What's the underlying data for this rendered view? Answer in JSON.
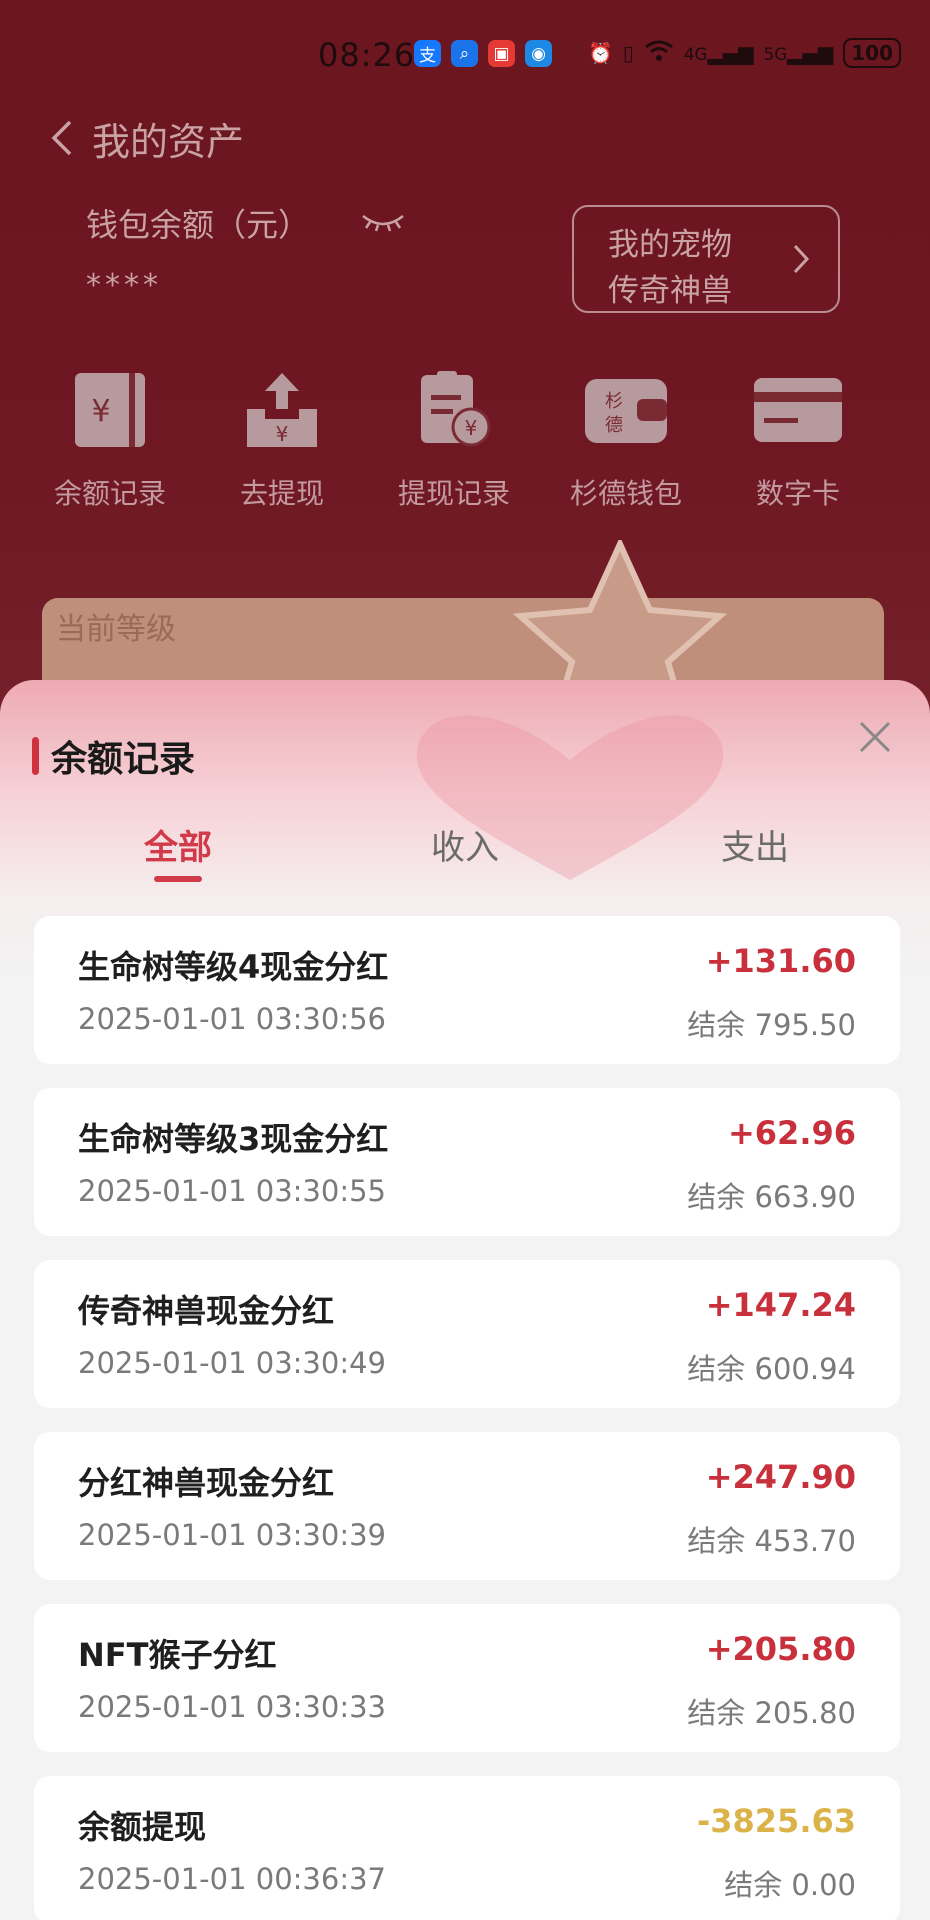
{
  "status_bar": {
    "time": "08:26",
    "app_icons": [
      {
        "icon": "alipay-icon",
        "glyph": "支",
        "color": "#1677ff"
      },
      {
        "icon": "search-app-icon",
        "glyph": "⌕",
        "color": "#1a73e8"
      },
      {
        "icon": "red-app-icon",
        "glyph": "▣",
        "color": "#e53935"
      },
      {
        "icon": "blue-app-icon",
        "glyph": "◉",
        "color": "#1e88e5"
      }
    ],
    "signal_4g": "4G",
    "signal_5g": "5G",
    "battery": "100"
  },
  "header": {
    "title": "我的资产"
  },
  "wallet": {
    "label": "钱包余额（元）",
    "amount_masked": "****"
  },
  "pet_box": {
    "line1": "我的宠物",
    "line2": "传奇神兽"
  },
  "quick_actions": [
    {
      "label": "余额记录",
      "icon": "balance-record-icon"
    },
    {
      "label": "去提现",
      "icon": "withdraw-icon"
    },
    {
      "label": "提现记录",
      "icon": "withdraw-record-icon"
    },
    {
      "label": "杉德钱包",
      "icon": "sande-wallet-icon"
    },
    {
      "label": "数字卡",
      "icon": "digital-card-icon"
    }
  ],
  "level_card": {
    "label": "当前等级"
  },
  "sheet": {
    "title": "余额记录",
    "tabs": [
      {
        "label": "全部",
        "active": true
      },
      {
        "label": "收入",
        "active": false
      },
      {
        "label": "支出",
        "active": false
      }
    ],
    "records": [
      {
        "title": "生命树等级4现金分红",
        "date": "2025-01-01 03:30:56",
        "amount": "+131.60",
        "balance": "结余 795.50",
        "type": "income"
      },
      {
        "title": "生命树等级3现金分红",
        "date": "2025-01-01 03:30:55",
        "amount": "+62.96",
        "balance": "结余 663.90",
        "type": "income"
      },
      {
        "title": "传奇神兽现金分红",
        "date": "2025-01-01 03:30:49",
        "amount": "+147.24",
        "balance": "结余 600.94",
        "type": "income"
      },
      {
        "title": "分红神兽现金分红",
        "date": "2025-01-01 03:30:39",
        "amount": "+247.90",
        "balance": "结余 453.70",
        "type": "income"
      },
      {
        "title": "NFT猴子分红",
        "date": "2025-01-01 03:30:33",
        "amount": "+205.80",
        "balance": "结余 205.80",
        "type": "income"
      },
      {
        "title": "余额提现",
        "date": "2025-01-01 00:36:37",
        "amount": "-3825.63",
        "balance": "结余 0.00",
        "type": "expense"
      }
    ]
  },
  "colors": {
    "income": "#c8303c",
    "expense": "#dcb349",
    "accent": "#d13a48"
  }
}
